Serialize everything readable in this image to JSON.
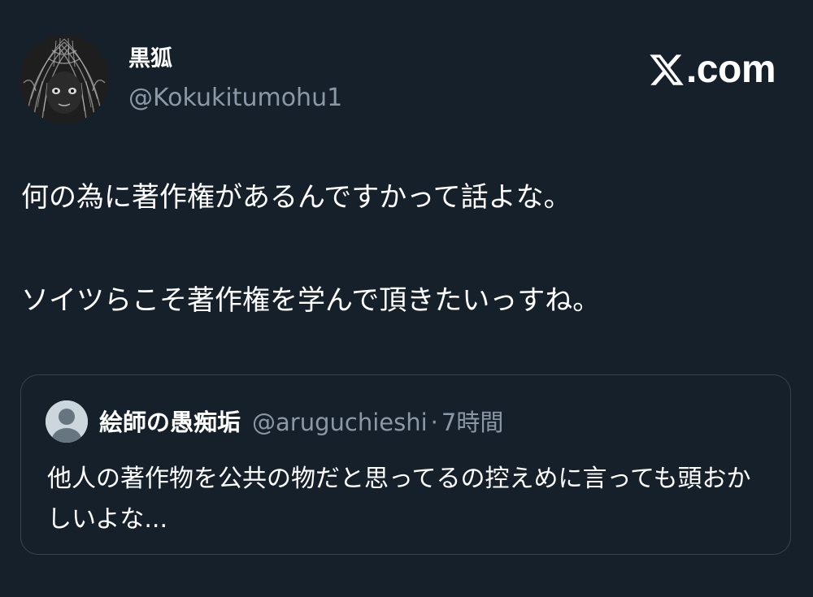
{
  "tweet": {
    "author": {
      "display_name": "黒狐",
      "handle": "@Kokukitumohu1",
      "avatar_icon": "monochrome-portrait-avatar"
    },
    "brand": {
      "logo_icon": "x-logo-icon",
      "text": ".com"
    },
    "text_lines": [
      "何の為に著作権があるんですかって話よな。",
      "ソイツらこそ著作権を学んで頂きたいっすね。"
    ]
  },
  "quoted_tweet": {
    "author": {
      "display_name": "絵師の愚痴垢",
      "handle": "@aruguchieshi",
      "avatar_icon": "default-user-avatar-icon"
    },
    "separator": "·",
    "time": "7時間",
    "text": "他人の著作物を公共の物だと思ってるの控えめに言っても頭おかしいよな..."
  },
  "colors": {
    "background": "#15202b",
    "text_primary": "#ffffff",
    "text_secondary": "#8b98a5",
    "border": "#38444d"
  }
}
